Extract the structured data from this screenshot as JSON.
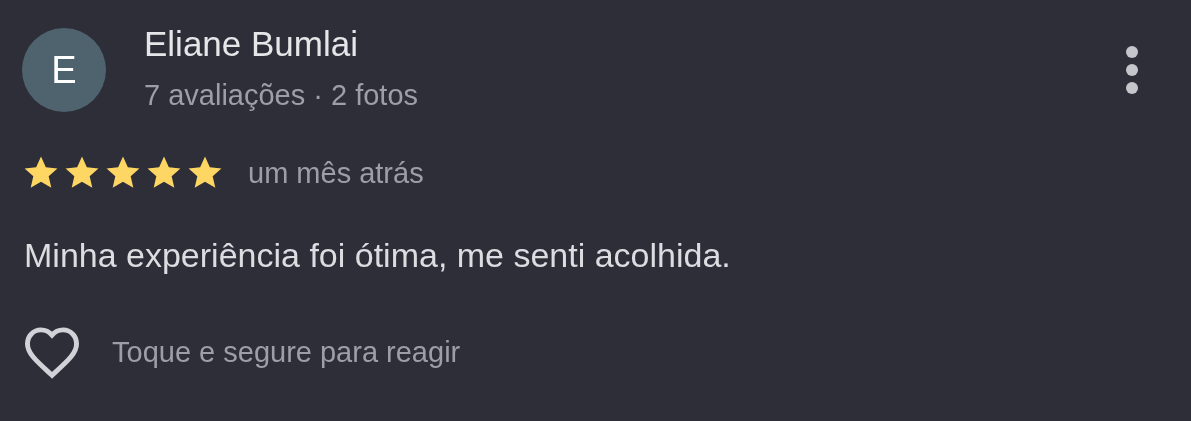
{
  "review": {
    "avatar_letter": "E",
    "author": "Eliane Bumlai",
    "meta": "7 avaliações · 2 fotos",
    "stars": 5,
    "time": "um mês atrás",
    "text": "Minha experiência foi ótima, me senti acolhida.",
    "react_hint": "Toque e segure para reagir"
  }
}
